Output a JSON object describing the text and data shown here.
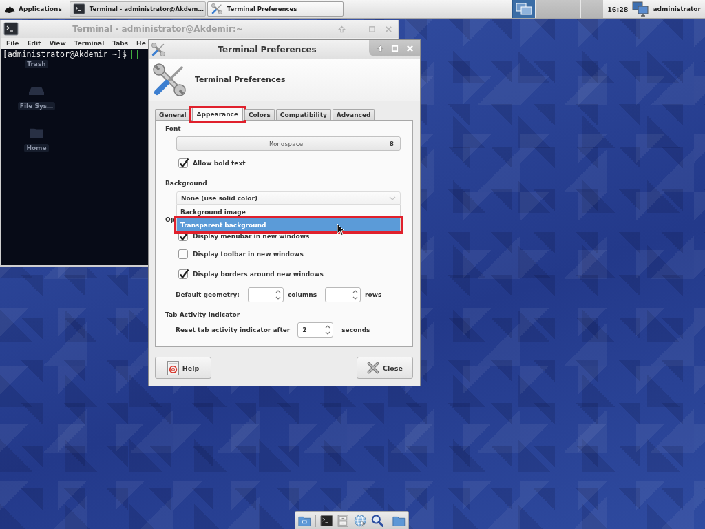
{
  "top_panel": {
    "applications": "Applications",
    "tasks": [
      {
        "label": "Terminal - administrator@Akdem…",
        "kind": "terminal",
        "selected": false
      },
      {
        "label": "Terminal Preferences",
        "kind": "preferences",
        "selected": true
      }
    ],
    "workspaces": [
      {
        "selected": true
      },
      {
        "selected": false
      },
      {
        "selected": false
      },
      {
        "selected": false
      }
    ],
    "clock": "16:28",
    "user": "administrator"
  },
  "terminal_window": {
    "title": "Terminal - administrator@Akdemir:~",
    "menu": [
      "File",
      "Edit",
      "View",
      "Terminal",
      "Tabs",
      "He"
    ],
    "prompt": "[administrator@Akdemir ~]$",
    "desktop_icons": [
      {
        "label": "Trash",
        "kind": "trash"
      },
      {
        "label": "File Sys…",
        "kind": "drive"
      },
      {
        "label": "Home",
        "kind": "folder"
      }
    ]
  },
  "preferences_dialog": {
    "title": "Terminal Preferences",
    "header": "Terminal Preferences",
    "tabs": [
      {
        "label": "General",
        "selected": false,
        "annotated": false
      },
      {
        "label": "Appearance",
        "selected": true,
        "annotated": true
      },
      {
        "label": "Colors",
        "selected": false,
        "annotated": false
      },
      {
        "label": "Compatibility",
        "selected": false,
        "annotated": false
      },
      {
        "label": "Advanced",
        "selected": false,
        "annotated": false
      }
    ],
    "appearance": {
      "font_heading": "Font",
      "font_name": "Monospace",
      "font_size": "8",
      "allow_bold": {
        "label": "Allow bold text",
        "checked": true
      },
      "background_heading": "Background",
      "background": {
        "value": "None (use solid color)",
        "expanded": true,
        "options": [
          {
            "label": "Background image",
            "selected": false,
            "annotated": false
          },
          {
            "label": "Transparent background",
            "selected": true,
            "annotated": true
          }
        ]
      },
      "windows_heading": "Op",
      "window_options": [
        {
          "label": "Display menubar in new windows",
          "checked": true
        },
        {
          "label": "Display toolbar in new windows",
          "checked": false
        },
        {
          "label": "Display borders around new windows",
          "checked": true
        }
      ],
      "geometry": {
        "label": "Default geometry:",
        "columns_unit": "columns",
        "rows_unit": "rows"
      },
      "tab_activity": {
        "heading": "Tab Activity Indicator",
        "label": "Reset tab activity indicator after",
        "value": "2",
        "unit": "seconds"
      }
    },
    "buttons": [
      {
        "label": "Help",
        "kind": "help"
      },
      {
        "label": "Close",
        "kind": "close"
      }
    ]
  }
}
